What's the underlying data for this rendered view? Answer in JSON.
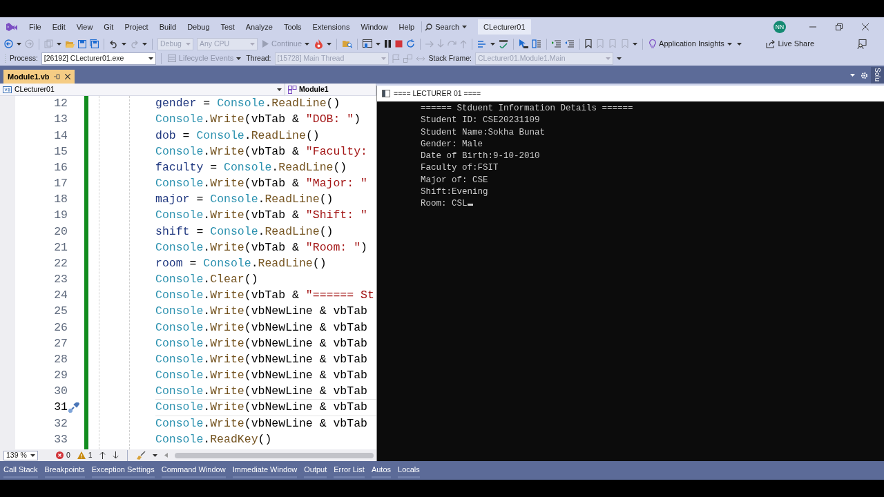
{
  "menu_bar": {
    "menus": [
      "File",
      "Edit",
      "View",
      "Git",
      "Project",
      "Build",
      "Debug",
      "Test",
      "Analyze",
      "Tools",
      "Extensions",
      "Window",
      "Help"
    ],
    "search": "Search",
    "solution_title": "CLecturer01",
    "avatar": "NN"
  },
  "toolbar": {
    "configuration": {
      "value": "Debug",
      "disabled": true
    },
    "platform": {
      "value": "Any CPU",
      "disabled": true
    },
    "continue": "Continue",
    "insights": "Application Insights",
    "live_share": "Live Share"
  },
  "debug_bar": {
    "process_label": "Process:",
    "process": {
      "value": "[26192] CLecturer01.exe",
      "disabled": false
    },
    "lifecycle": "Lifecycle Events",
    "thread_label": "Thread:",
    "thread": {
      "value": "[15728] Main Thread",
      "disabled": true
    },
    "stack_frame_label": "Stack Frame:",
    "stack_frame": {
      "value": "CLecturer01.Module1.Main",
      "disabled": true
    }
  },
  "document_tabs": [
    {
      "title": "Module1.vb",
      "selected": true
    }
  ],
  "side_tab": "Solu",
  "editor": {
    "project": "CLecturer01",
    "member": "Module1",
    "zoom": "139 %",
    "errors": "0",
    "warnings": "1",
    "lines": [
      {
        "number": "12",
        "current": false,
        "tokens": [
          {
            "text": "gender",
            "kind": "var"
          },
          {
            "text": " = ",
            "kind": "plain"
          },
          {
            "text": "Console",
            "kind": "type"
          },
          {
            "text": ".",
            "kind": "plain"
          },
          {
            "text": "ReadLine",
            "kind": "method"
          },
          {
            "text": "()",
            "kind": "plain"
          }
        ]
      },
      {
        "number": "13",
        "current": false,
        "tokens": [
          {
            "text": "Console",
            "kind": "type"
          },
          {
            "text": ".",
            "kind": "plain"
          },
          {
            "text": "Write",
            "kind": "method"
          },
          {
            "text": "(vbTab & ",
            "kind": "plain"
          },
          {
            "text": "\"DOB: \"",
            "kind": "string"
          },
          {
            "text": ")",
            "kind": "plain"
          }
        ]
      },
      {
        "number": "14",
        "current": false,
        "tokens": [
          {
            "text": "dob",
            "kind": "var"
          },
          {
            "text": " = ",
            "kind": "plain"
          },
          {
            "text": "Console",
            "kind": "type"
          },
          {
            "text": ".",
            "kind": "plain"
          },
          {
            "text": "ReadLine",
            "kind": "method"
          },
          {
            "text": "()",
            "kind": "plain"
          }
        ]
      },
      {
        "number": "15",
        "current": false,
        "tokens": [
          {
            "text": "Console",
            "kind": "type"
          },
          {
            "text": ".",
            "kind": "plain"
          },
          {
            "text": "Write",
            "kind": "method"
          },
          {
            "text": "(vbTab & ",
            "kind": "plain"
          },
          {
            "text": "\"Faculty:",
            "kind": "string"
          }
        ]
      },
      {
        "number": "16",
        "current": false,
        "tokens": [
          {
            "text": "faculty",
            "kind": "var"
          },
          {
            "text": " = ",
            "kind": "plain"
          },
          {
            "text": "Console",
            "kind": "type"
          },
          {
            "text": ".",
            "kind": "plain"
          },
          {
            "text": "ReadLine",
            "kind": "method"
          },
          {
            "text": "()",
            "kind": "plain"
          }
        ]
      },
      {
        "number": "17",
        "current": false,
        "tokens": [
          {
            "text": "Console",
            "kind": "type"
          },
          {
            "text": ".",
            "kind": "plain"
          },
          {
            "text": "Write",
            "kind": "method"
          },
          {
            "text": "(vbTab & ",
            "kind": "plain"
          },
          {
            "text": "\"Major: \"",
            "kind": "string"
          }
        ]
      },
      {
        "number": "18",
        "current": false,
        "tokens": [
          {
            "text": "major",
            "kind": "var"
          },
          {
            "text": " = ",
            "kind": "plain"
          },
          {
            "text": "Console",
            "kind": "type"
          },
          {
            "text": ".",
            "kind": "plain"
          },
          {
            "text": "ReadLine",
            "kind": "method"
          },
          {
            "text": "()",
            "kind": "plain"
          }
        ]
      },
      {
        "number": "19",
        "current": false,
        "tokens": [
          {
            "text": "Console",
            "kind": "type"
          },
          {
            "text": ".",
            "kind": "plain"
          },
          {
            "text": "Write",
            "kind": "method"
          },
          {
            "text": "(vbTab & ",
            "kind": "plain"
          },
          {
            "text": "\"Shift: \"",
            "kind": "string"
          }
        ]
      },
      {
        "number": "20",
        "current": false,
        "tokens": [
          {
            "text": "shift",
            "kind": "var"
          },
          {
            "text": " = ",
            "kind": "plain"
          },
          {
            "text": "Console",
            "kind": "type"
          },
          {
            "text": ".",
            "kind": "plain"
          },
          {
            "text": "ReadLine",
            "kind": "method"
          },
          {
            "text": "()",
            "kind": "plain"
          }
        ]
      },
      {
        "number": "21",
        "current": false,
        "tokens": [
          {
            "text": "Console",
            "kind": "type"
          },
          {
            "text": ".",
            "kind": "plain"
          },
          {
            "text": "Write",
            "kind": "method"
          },
          {
            "text": "(vbTab & ",
            "kind": "plain"
          },
          {
            "text": "\"Room: \"",
            "kind": "string"
          },
          {
            "text": ")",
            "kind": "plain"
          }
        ]
      },
      {
        "number": "22",
        "current": false,
        "tokens": [
          {
            "text": "room",
            "kind": "var"
          },
          {
            "text": " = ",
            "kind": "plain"
          },
          {
            "text": "Console",
            "kind": "type"
          },
          {
            "text": ".",
            "kind": "plain"
          },
          {
            "text": "ReadLine",
            "kind": "method"
          },
          {
            "text": "()",
            "kind": "plain"
          }
        ]
      },
      {
        "number": "23",
        "current": false,
        "tokens": [
          {
            "text": "Console",
            "kind": "type"
          },
          {
            "text": ".",
            "kind": "plain"
          },
          {
            "text": "Clear",
            "kind": "method"
          },
          {
            "text": "()",
            "kind": "plain"
          }
        ]
      },
      {
        "number": "24",
        "current": false,
        "tokens": [
          {
            "text": "Console",
            "kind": "type"
          },
          {
            "text": ".",
            "kind": "plain"
          },
          {
            "text": "Write",
            "kind": "method"
          },
          {
            "text": "(vbTab & ",
            "kind": "plain"
          },
          {
            "text": "\"====== St",
            "kind": "string"
          }
        ]
      },
      {
        "number": "25",
        "current": false,
        "tokens": [
          {
            "text": "Console",
            "kind": "type"
          },
          {
            "text": ".",
            "kind": "plain"
          },
          {
            "text": "Write",
            "kind": "method"
          },
          {
            "text": "(vbNewLine & vbTab",
            "kind": "plain"
          }
        ]
      },
      {
        "number": "26",
        "current": false,
        "tokens": [
          {
            "text": "Console",
            "kind": "type"
          },
          {
            "text": ".",
            "kind": "plain"
          },
          {
            "text": "Write",
            "kind": "method"
          },
          {
            "text": "(vbNewLine & vbTab",
            "kind": "plain"
          }
        ]
      },
      {
        "number": "27",
        "current": false,
        "tokens": [
          {
            "text": "Console",
            "kind": "type"
          },
          {
            "text": ".",
            "kind": "plain"
          },
          {
            "text": "Write",
            "kind": "method"
          },
          {
            "text": "(vbNewLine & vbTab",
            "kind": "plain"
          }
        ]
      },
      {
        "number": "28",
        "current": false,
        "tokens": [
          {
            "text": "Console",
            "kind": "type"
          },
          {
            "text": ".",
            "kind": "plain"
          },
          {
            "text": "Write",
            "kind": "method"
          },
          {
            "text": "(vbNewLine & vbTab",
            "kind": "plain"
          }
        ]
      },
      {
        "number": "29",
        "current": false,
        "tokens": [
          {
            "text": "Console",
            "kind": "type"
          },
          {
            "text": ".",
            "kind": "plain"
          },
          {
            "text": "Write",
            "kind": "method"
          },
          {
            "text": "(vbNewLine & vbTab",
            "kind": "plain"
          }
        ]
      },
      {
        "number": "30",
        "current": false,
        "tokens": [
          {
            "text": "Console",
            "kind": "type"
          },
          {
            "text": ".",
            "kind": "plain"
          },
          {
            "text": "Write",
            "kind": "method"
          },
          {
            "text": "(vbNewLine & vbTab",
            "kind": "plain"
          }
        ]
      },
      {
        "number": "31",
        "current": true,
        "tokens": [
          {
            "text": "Console",
            "kind": "type"
          },
          {
            "text": ".",
            "kind": "plain"
          },
          {
            "text": "Write",
            "kind": "method"
          },
          {
            "text": "(vbNewLine & vbTab",
            "kind": "plain"
          }
        ]
      },
      {
        "number": "32",
        "current": false,
        "tokens": [
          {
            "text": "Console",
            "kind": "type"
          },
          {
            "text": ".",
            "kind": "plain"
          },
          {
            "text": "Write",
            "kind": "method"
          },
          {
            "text": "(vbNewLine & vbTab",
            "kind": "plain"
          }
        ]
      },
      {
        "number": "33",
        "current": false,
        "tokens": [
          {
            "text": "Console",
            "kind": "type"
          },
          {
            "text": ".",
            "kind": "plain"
          },
          {
            "text": "ReadKey",
            "kind": "method"
          },
          {
            "text": "()",
            "kind": "plain"
          }
        ]
      }
    ]
  },
  "console": {
    "title": "==== LECTURER 01 ====",
    "lines": [
      "====== Stduent Information Details ======",
      "Student ID: CSE20231109",
      "Student Name:Sokha Bunat",
      "Gender: Male",
      "Date of Birth:9-10-2010",
      "Faculty of:FSIT",
      "Major of: CSE",
      "Shift:Evening",
      "Room: CSL"
    ]
  },
  "tool_tabs": [
    "Call Stack",
    "Breakpoints",
    "Exception Settings",
    "Command Window",
    "Immediate Window",
    "Output",
    "Error List",
    "Autos",
    "Locals"
  ]
}
